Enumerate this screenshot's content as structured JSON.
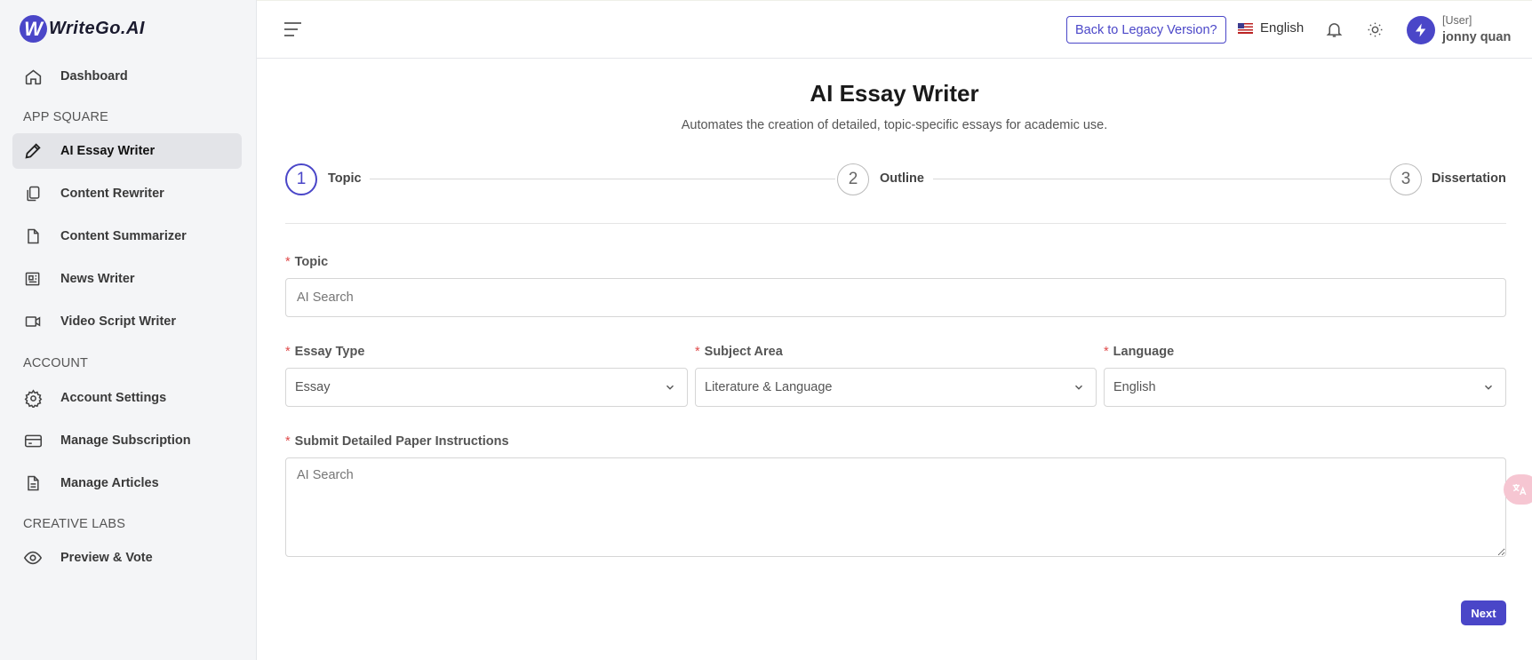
{
  "brand": {
    "logo_letter": "W",
    "name": "WriteGo.AI",
    "accent": "#4a46c8"
  },
  "sidebar": {
    "dashboard": "Dashboard",
    "section_app": "APP SQUARE",
    "items": [
      {
        "label": "AI Essay Writer",
        "icon": "pencil-icon",
        "active": true
      },
      {
        "label": "Content Rewriter",
        "icon": "copy-icon"
      },
      {
        "label": "Content Summarizer",
        "icon": "file-icon"
      },
      {
        "label": "News Writer",
        "icon": "newspaper-icon"
      },
      {
        "label": "Video Script Writer",
        "icon": "video-icon"
      }
    ],
    "section_account": "ACCOUNT",
    "account_items": [
      {
        "label": "Account Settings",
        "icon": "gear-icon"
      },
      {
        "label": "Manage Subscription",
        "icon": "credit-card-icon"
      },
      {
        "label": "Manage Articles",
        "icon": "document-icon"
      }
    ],
    "section_labs": "CREATIVE LABS",
    "labs_items": [
      {
        "label": "Preview & Vote",
        "icon": "eye-icon"
      }
    ]
  },
  "header": {
    "legacy_button": "Back to Legacy Version?",
    "language": "English",
    "user_role": "[User]",
    "user_name": "jonny quan"
  },
  "main": {
    "title": "AI Essay Writer",
    "subtitle": "Automates the creation of detailed, topic-specific essays for academic use.",
    "steps": [
      {
        "number": "1",
        "label": "Topic",
        "active": true
      },
      {
        "number": "2",
        "label": "Outline"
      },
      {
        "number": "3",
        "label": "Dissertation"
      }
    ],
    "form": {
      "required_mark": "*",
      "topic_label": "Topic",
      "topic_placeholder": "AI Search",
      "essay_type_label": "Essay Type",
      "essay_type_value": "Essay",
      "subject_area_label": "Subject Area",
      "subject_area_value": "Literature & Language",
      "language_label": "Language",
      "language_value": "English",
      "instructions_label": "Submit Detailed Paper Instructions",
      "instructions_placeholder": "AI Search"
    },
    "next_button": "Next"
  }
}
